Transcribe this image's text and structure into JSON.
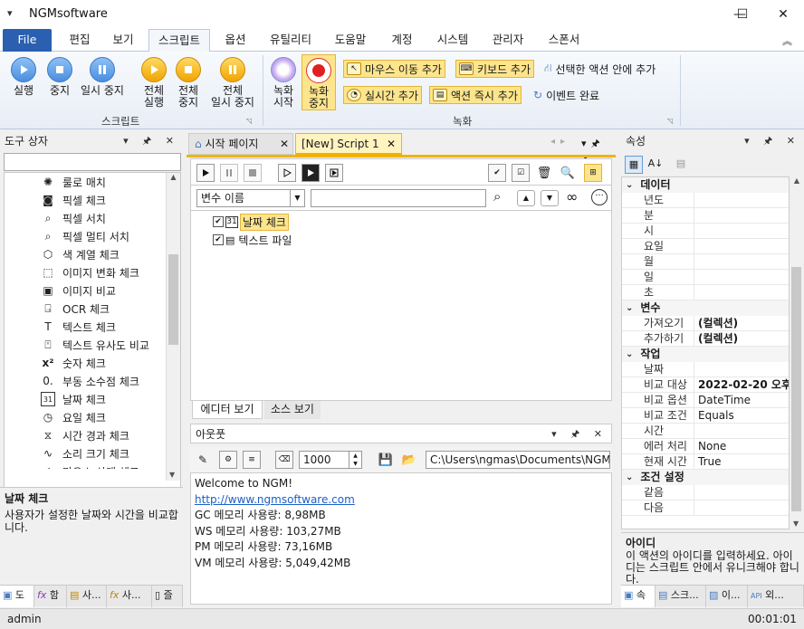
{
  "window": {
    "title": "NGMsoftware",
    "quick_access": "▾",
    "minimize": "—",
    "maximize": "☐",
    "close": "✕"
  },
  "ribbon_tabs": [
    "File",
    "편집",
    "보기",
    "스크립트",
    "옵션",
    "유틸리티",
    "도움말",
    "계정",
    "시스템",
    "관리자",
    "스폰서"
  ],
  "ribbon": {
    "script_group": {
      "label": "스크립트",
      "run": "실행",
      "stop": "중지",
      "pause": "일시 중지",
      "run_all": "전체\n실행",
      "stop_all": "전체\n중지",
      "pause_all": "전체\n일시 중지"
    },
    "record_group": {
      "label": "녹화",
      "record_start": "녹화\n시작",
      "record_stop": "녹화\n중지",
      "add_mouse_move": "마우스 이동 추가",
      "add_keyboard": "키보드 추가",
      "add_in_selected": "선택한 액션 안에 추가",
      "add_realtime": "실시간 추가",
      "add_action_now": "액션 즉시 추가",
      "event_done": "이벤트 완료"
    }
  },
  "left_panel": {
    "title": "도구 상자",
    "items": [
      {
        "label": "룰로 매치",
        "icon": "wheel-icon"
      },
      {
        "label": "픽셀 체크",
        "icon": "camera-icon"
      },
      {
        "label": "픽셀 서치",
        "icon": "magnifier-icon"
      },
      {
        "label": "픽셀 멀티 서치",
        "icon": "magnifier-icon"
      },
      {
        "label": "색 계열 체크",
        "icon": "cube-icon"
      },
      {
        "label": "이미지 변화 체크",
        "icon": "image-change-icon"
      },
      {
        "label": "이미지 비교",
        "icon": "image-compare-icon"
      },
      {
        "label": "OCR 체크",
        "icon": "ocr-icon"
      },
      {
        "label": "텍스트 체크",
        "icon": "text-icon"
      },
      {
        "label": "텍스트 유사도 비교",
        "icon": "text-similar-icon"
      },
      {
        "label": "숫자 체크",
        "icon": "number-icon"
      },
      {
        "label": "부동 소수점 체크",
        "icon": "float-icon"
      },
      {
        "label": "날짜 체크",
        "icon": "calendar-icon"
      },
      {
        "label": "요일 체크",
        "icon": "weekday-icon"
      },
      {
        "label": "시간 경과 체크",
        "icon": "clock-icon"
      },
      {
        "label": "소리 크기 체크",
        "icon": "sound-icon"
      },
      {
        "label": "마우스 상태 체크",
        "icon": "mouse-icon"
      }
    ],
    "desc_title": "날짜 체크",
    "desc_text": "사용자가 설정한 날짜와 시간을 비교합니다.",
    "bottom_tabs": [
      "도",
      "함",
      "사...",
      "사...",
      "즐"
    ]
  },
  "doc": {
    "tabs": [
      "시작 페이지",
      "[New] Script 1"
    ],
    "var_select": "변수 이름",
    "tree_items": [
      {
        "label": "날짜 체크",
        "checked": true
      },
      {
        "label": "텍스트 파일",
        "checked": true
      }
    ],
    "bottom_tabs": [
      "에디터 보기",
      "소스 보기"
    ]
  },
  "output": {
    "title": "아웃풋",
    "count": "1000",
    "path": "C:\\Users\\ngmas\\Documents\\NGM6\\",
    "lines": {
      "welcome": "Welcome to NGM!",
      "link": "http://www.ngmsoftware.com",
      "gc": "GC 메모리 사용량: 8,98MB",
      "ws": "WS 메모리 사용량: 103,27MB",
      "pm": "PM 메모리 사용량: 73,16MB",
      "vm": "VM 메모리 사용량: 5,049,42MB"
    }
  },
  "right_panel": {
    "title": "속성",
    "categories": [
      {
        "name": "데이터",
        "rows": [
          [
            "년도",
            ""
          ],
          [
            "분",
            ""
          ],
          [
            "시",
            ""
          ],
          [
            "요일",
            ""
          ],
          [
            "월",
            ""
          ],
          [
            "일",
            ""
          ],
          [
            "초",
            ""
          ]
        ]
      },
      {
        "name": "변수",
        "rows": [
          [
            "가져오기",
            "(컬렉션)"
          ],
          [
            "추가하기",
            "(컬렉션)"
          ]
        ]
      },
      {
        "name": "작업",
        "rows": [
          [
            "날짜",
            ""
          ],
          [
            "비교 대상",
            "2022-02-20 오후"
          ],
          [
            "비교 옵션",
            "DateTime"
          ],
          [
            "비교 조건",
            "Equals"
          ],
          [
            "시간",
            ""
          ],
          [
            "에러 처리",
            "None"
          ],
          [
            "현재 시간",
            "True"
          ]
        ]
      },
      {
        "name": "조건 설정",
        "rows": [
          [
            "같음",
            ""
          ],
          [
            "다음",
            ""
          ]
        ]
      }
    ],
    "desc_title": "아이디",
    "desc_text": "이 액션의 아이디를 입력하세요. 아이디는 스크립트 안에서 유니크해야 합니다.",
    "bottom_tabs": [
      "속",
      "스크...",
      "이...",
      "외..."
    ]
  },
  "status": {
    "user": "admin",
    "time": "00:01:01"
  },
  "colors": {
    "file_tab": "#2b5fb0",
    "accent_blue": "#4a8ee0",
    "accent_gold": "#f0a400",
    "highlight": "#fde58d"
  }
}
